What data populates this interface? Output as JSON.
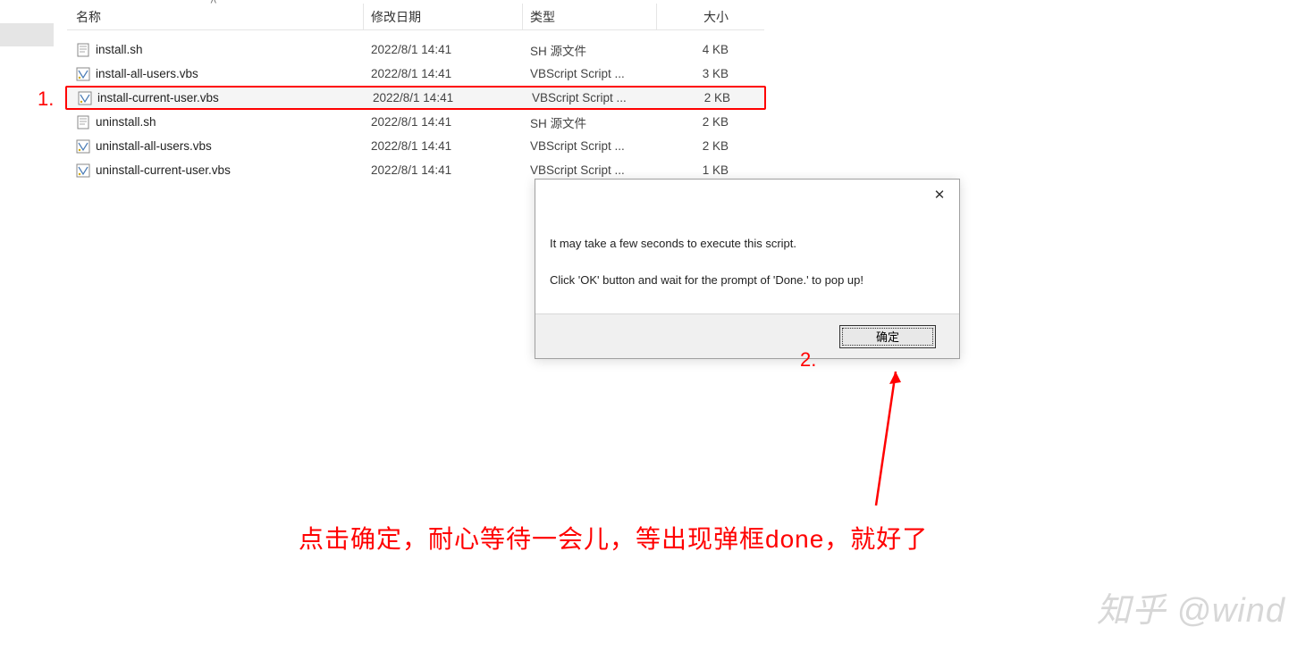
{
  "columns": {
    "name": "名称",
    "date": "修改日期",
    "type": "类型",
    "size": "大小"
  },
  "files": [
    {
      "icon": "sh",
      "name": "install.sh",
      "date": "2022/8/1 14:41",
      "type": "SH 源文件",
      "size": "4 KB",
      "highlighted": false
    },
    {
      "icon": "vbs",
      "name": "install-all-users.vbs",
      "date": "2022/8/1 14:41",
      "type": "VBScript Script ...",
      "size": "3 KB",
      "highlighted": false
    },
    {
      "icon": "vbs",
      "name": "install-current-user.vbs",
      "date": "2022/8/1 14:41",
      "type": "VBScript Script ...",
      "size": "2 KB",
      "highlighted": true
    },
    {
      "icon": "sh",
      "name": "uninstall.sh",
      "date": "2022/8/1 14:41",
      "type": "SH 源文件",
      "size": "2 KB",
      "highlighted": false
    },
    {
      "icon": "vbs",
      "name": "uninstall-all-users.vbs",
      "date": "2022/8/1 14:41",
      "type": "VBScript Script ...",
      "size": "2 KB",
      "highlighted": false
    },
    {
      "icon": "vbs",
      "name": "uninstall-current-user.vbs",
      "date": "2022/8/1 14:41",
      "type": "VBScript Script ...",
      "size": "1 KB",
      "highlighted": false
    }
  ],
  "dialog": {
    "line1": "It may take a few seconds to execute this script.",
    "line2": "Click 'OK' button and wait for the prompt of 'Done.' to pop up!",
    "ok_label": "确定",
    "close_label": "✕"
  },
  "annotations": {
    "step1": "1.",
    "step2": "2.",
    "instruction": "点击确定，耐心等待一会儿，等出现弹框done，就好了"
  },
  "watermark": "知乎 @wind"
}
